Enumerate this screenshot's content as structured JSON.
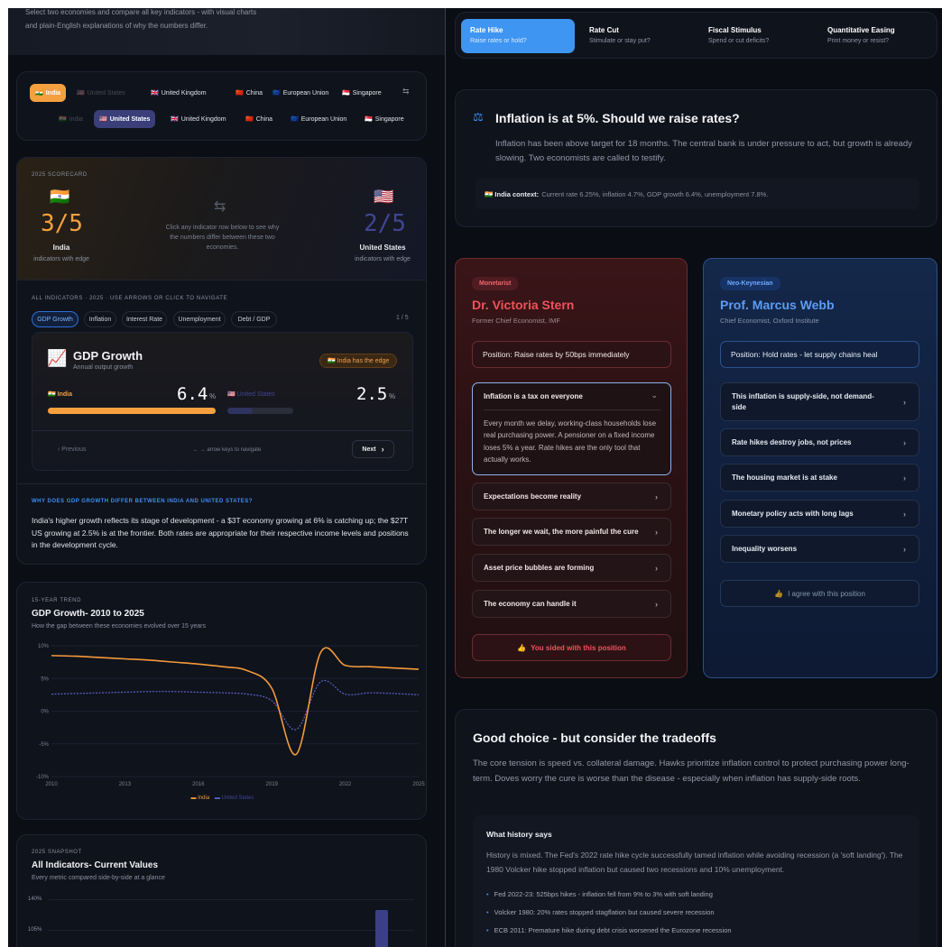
{
  "intro": {
    "line1": "Select two economies and compare all key indicators - with visual charts",
    "line2": "and plain-English explanations of why the numbers differ."
  },
  "selector": {
    "row1": [
      {
        "flag": "🇮🇳",
        "label": "India",
        "state": "active"
      },
      {
        "flag": "🇺🇸",
        "label": "United States",
        "state": "disabled"
      },
      {
        "flag": "🇬🇧",
        "label": "United Kingdom",
        "state": "normal"
      },
      {
        "flag": "🇨🇳",
        "label": "China",
        "state": "normal"
      },
      {
        "flag": "🇪🇺",
        "label": "European Union",
        "state": "normal"
      },
      {
        "flag": "🇸🇬",
        "label": "Singapore",
        "state": "normal"
      }
    ],
    "swap_icon": "⇆",
    "row2": [
      {
        "flag": "🇮🇳",
        "label": "India",
        "state": "disabled"
      },
      {
        "flag": "🇺🇸",
        "label": "United States",
        "state": "active"
      },
      {
        "flag": "🇬🇧",
        "label": "United Kingdom",
        "state": "normal"
      },
      {
        "flag": "🇨🇳",
        "label": "China",
        "state": "normal"
      },
      {
        "flag": "🇪🇺",
        "label": "European Union",
        "state": "normal"
      },
      {
        "flag": "🇸🇬",
        "label": "Singapore",
        "state": "normal"
      }
    ]
  },
  "scorecard": {
    "label": "2025 SCORECARD",
    "left": {
      "flag": "🇮🇳",
      "score": "3/5",
      "name": "India",
      "sub": "indicators with edge"
    },
    "right": {
      "flag": "🇺🇸",
      "score": "2/5",
      "name": "United States",
      "sub": "indicators with edge"
    },
    "swap_glyph": "⇆",
    "hint": "Click any indicator row below to see why the numbers differ between these two economies."
  },
  "indicators": {
    "label": "ALL INDICATORS · 2025 · USE ARROWS OR CLICK TO NAVIGATE",
    "tabs": [
      "GDP Growth",
      "Inflation",
      "Interest Rate",
      "Unemployment",
      "Debt / GDP"
    ],
    "counter": "1 / 5",
    "card": {
      "icon": "📈",
      "title": "GDP Growth",
      "subtitle": "Annual output growth",
      "edge_badge": "🇮🇳 India has the edge",
      "left_label": "🇮🇳 India",
      "left_value": "6.4",
      "left_unit": "%",
      "left_fill": 1.0,
      "right_label": "🇺🇸 United States",
      "right_value": "2.5",
      "right_unit": "%",
      "right_fill": 0.39
    },
    "prev": "‹  Previous",
    "nav_hint": "← → arrow keys to navigate",
    "next": "Next",
    "next_icon": "›"
  },
  "why": {
    "label": "WHY DOES GDP GROWTH DIFFER BETWEEN INDIA AND UNITED STATES?",
    "text": "India's higher growth reflects its stage of development - a $3T economy growing at 6% is catching up; the $27T US growing at 2.5% is at the frontier. Both rates are appropriate for their respective income levels and positions in the development cycle."
  },
  "trend": {
    "label": "15-YEAR TREND",
    "title": "GDP Growth- 2010 to 2025",
    "subtitle": "How the gap between these economies evolved over 15 years",
    "legend_a": "India",
    "legend_b": "United States"
  },
  "chart_data": {
    "type": "line",
    "title": "GDP Growth- 2010 to 2025",
    "x": [
      2010,
      2011,
      2012,
      2013,
      2014,
      2015,
      2016,
      2017,
      2018,
      2019,
      2020,
      2021,
      2022,
      2023,
      2024,
      2025
    ],
    "xticks": [
      "2010",
      "2013",
      "2016",
      "2019",
      "2022",
      "2025"
    ],
    "yticks": [
      "10%",
      "5%",
      "0%",
      "-5%",
      "-10%"
    ],
    "ylim": [
      -10,
      10
    ],
    "series": [
      {
        "name": "India",
        "color": "#f59a3a",
        "values": [
          8.5,
          8.4,
          8.2,
          8.0,
          7.8,
          7.5,
          7.2,
          6.8,
          6.2,
          3.5,
          -6.6,
          9.0,
          7.0,
          6.8,
          6.6,
          6.4
        ]
      },
      {
        "name": "United States",
        "color": "#5b63c9",
        "values": [
          2.6,
          2.7,
          2.8,
          2.9,
          3.0,
          3.0,
          2.9,
          2.8,
          2.6,
          1.6,
          -2.8,
          4.5,
          2.6,
          2.8,
          2.7,
          2.5
        ]
      }
    ]
  },
  "snapshot": {
    "label": "2025 SNAPSHOT",
    "title": "All Indicators- Current Values",
    "subtitle": "Every metric compared side-by-side at a glance",
    "yticks": [
      "140%",
      "105%"
    ]
  },
  "modes": [
    {
      "title": "Rate Hike",
      "sub": "Raise rates or hold?",
      "active": true
    },
    {
      "title": "Rate Cut",
      "sub": "Stimulate or stay put?",
      "active": false
    },
    {
      "title": "Fiscal Stimulus",
      "sub": "Spend or cut deficits?",
      "active": false
    },
    {
      "title": "Quantitative Easing",
      "sub": "Print money or resist?",
      "active": false
    }
  ],
  "scenario": {
    "icon": "⚖",
    "title": "Inflation is at 5%. Should we raise rates?",
    "body": "Inflation has been above target for 18 months. The central bank is under pressure to act, but growth is already slowing. Two economists are called to testify.",
    "context_label": "🇮🇳 India context:",
    "context_text": "Current rate 6.25%, inflation 4.7%, GDP growth 6.4%, unemployment 7.8%."
  },
  "hawk": {
    "badge": "Monetarist",
    "name": "Dr. Victoria Stern",
    "role": "Former Chief Economist, IMF",
    "position": "Position: Raise rates by 50bps immediately",
    "expanded_title": "Inflation is a tax on everyone",
    "expanded_body": "Every month we delay, working-class households lose real purchasing power. A pensioner on a fixed income loses 5% a year. Rate hikes are the only tool that actually works.",
    "arguments": [
      "Expectations become reality",
      "The longer we wait, the more painful the cure",
      "Asset price bubbles are forming",
      "The economy can handle it"
    ],
    "sided": "You sided with this position"
  },
  "dove": {
    "badge": "Neo-Keynesian",
    "name": "Prof. Marcus Webb",
    "role": "Chief Economist, Oxford Institute",
    "position": "Position: Hold rates - let supply chains heal",
    "arguments": [
      "This inflation is supply-side, not demand-side",
      "Rate hikes destroy jobs, not prices",
      "The housing market is at stake",
      "Monetary policy acts with long lags",
      "Inequality worsens"
    ],
    "agree": "I agree with this position"
  },
  "verdict": {
    "title": "Good choice - but consider the tradeoffs",
    "body": "The core tension is speed vs. collateral damage. Hawks prioritize inflation control to protect purchasing power long-term. Doves worry the cure is worse than the disease - especially when inflation has supply-side roots.",
    "history_title": "What history says",
    "history_body": "History is mixed. The Fed's 2022 rate hike cycle successfully tamed inflation while avoiding recession (a 'soft landing'). The 1980 Volcker hike stopped inflation but caused two recessions and 10% unemployment.",
    "history_items": [
      "Fed 2022-23: 525bps hikes - inflation fell from 9% to 3% with soft landing",
      "Volcker 1980: 20% rates stopped stagflation but caused severe recession",
      "ECB 2011: Premature hike during debt crisis worsened the Eurozone recession"
    ]
  }
}
